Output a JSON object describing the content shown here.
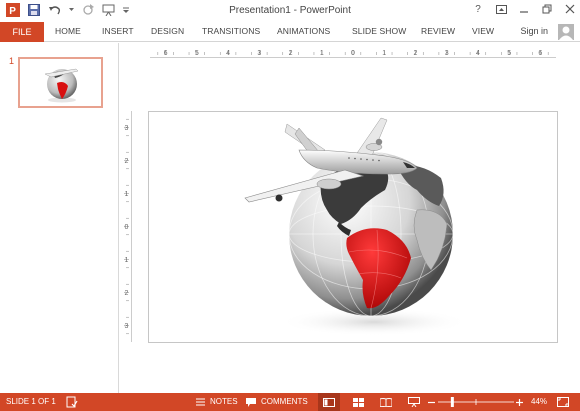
{
  "window": {
    "title": "Presentation1 - PowerPoint"
  },
  "titlebar_controls": {
    "help": "?"
  },
  "ribbon": {
    "file_label": "FILE",
    "tabs": [
      "HOME",
      "INSERT",
      "DESIGN",
      "TRANSITIONS",
      "ANIMATIONS",
      "SLIDE SHOW",
      "REVIEW",
      "VIEW"
    ],
    "signin_label": "Sign in"
  },
  "thumbnails": [
    {
      "number": "1"
    }
  ],
  "ruler": {
    "horizontal_labels": [
      "6",
      "5",
      "4",
      "3",
      "2",
      "1",
      "0",
      "1",
      "2",
      "3",
      "4",
      "5",
      "6"
    ],
    "vertical_labels": [
      "3",
      "2",
      "1",
      "0",
      "1",
      "2",
      "3"
    ]
  },
  "statusbar": {
    "slide_indicator": "SLIDE 1 OF 1",
    "notes_label": "NOTES",
    "comments_label": "COMMENTS",
    "zoom_label": "44%",
    "zoom_level": 0.44
  },
  "colors": {
    "accent": "#d24726",
    "accent_dark": "#a8361b",
    "south_america": "#d80f0f",
    "thumb_border": "#e8a28f"
  },
  "icons": {
    "app": "powerpoint-logo-icon",
    "save": "save-icon",
    "undo": "undo-icon",
    "redo": "redo-icon",
    "presenter": "start-presentation-icon",
    "customize": "customize-qat-icon"
  }
}
